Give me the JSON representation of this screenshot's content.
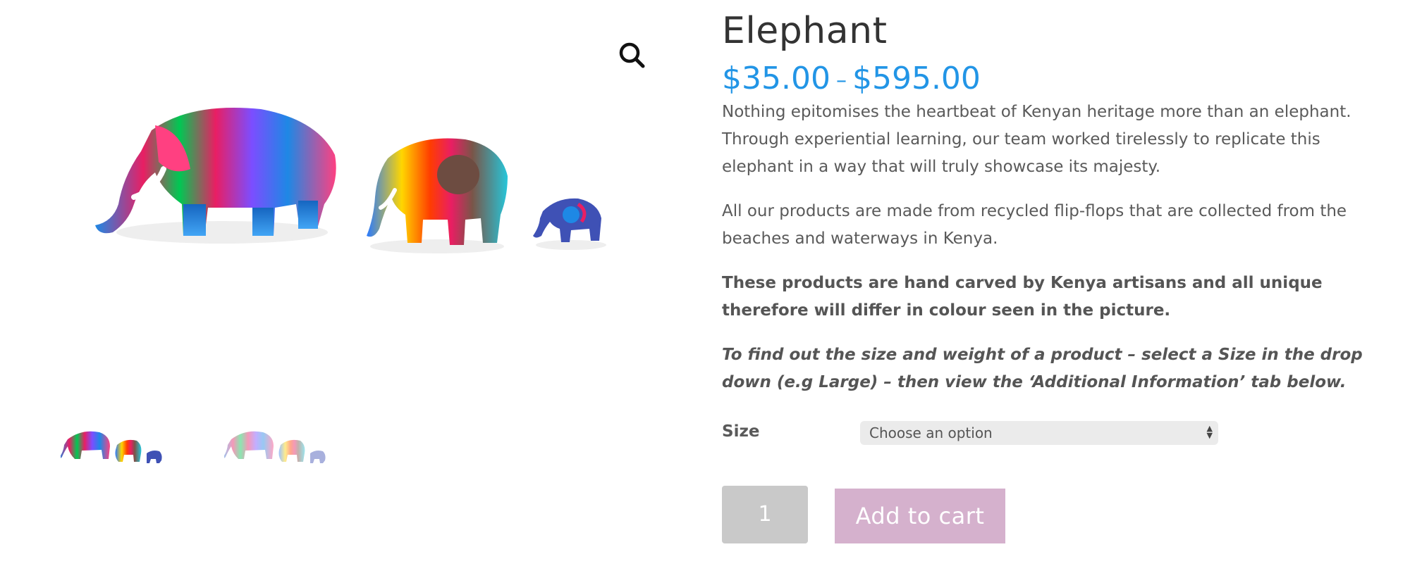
{
  "product": {
    "title": "Elephant",
    "price_min": "$35.00",
    "price_sep": "–",
    "price_max": "$595.00",
    "description": [
      "Nothing epitomises the heartbeat of Kenyan heritage more than an elephant. Through experiential learning, our team worked tirelessly to replicate this elephant in a way that will truly showcase its majesty.",
      "All our products are made from recycled flip-flops that are collected from the beaches and waterways in Kenya.",
      "These products are hand carved by Kenya artisans and all unique therefore will differ in colour seen in the picture.",
      "To find out the size and weight of a product – select a Size in the drop down (e.g Large) – then view the ‘Additional Information’ tab below."
    ]
  },
  "variation": {
    "label": "Size",
    "select_value": "Choose an option"
  },
  "cart": {
    "quantity": "1",
    "button_label": "Add to cart"
  },
  "gallery": {
    "zoom_icon": "magnifier-icon",
    "thumbnails": [
      "elephant-family-thumb",
      "elephant-family-thumb-faded"
    ]
  },
  "colors": {
    "price": "#2295e6",
    "add_to_cart_bg": "#d5b1cd",
    "quantity_bg": "#c9c9c9",
    "select_bg": "#ebebeb"
  }
}
